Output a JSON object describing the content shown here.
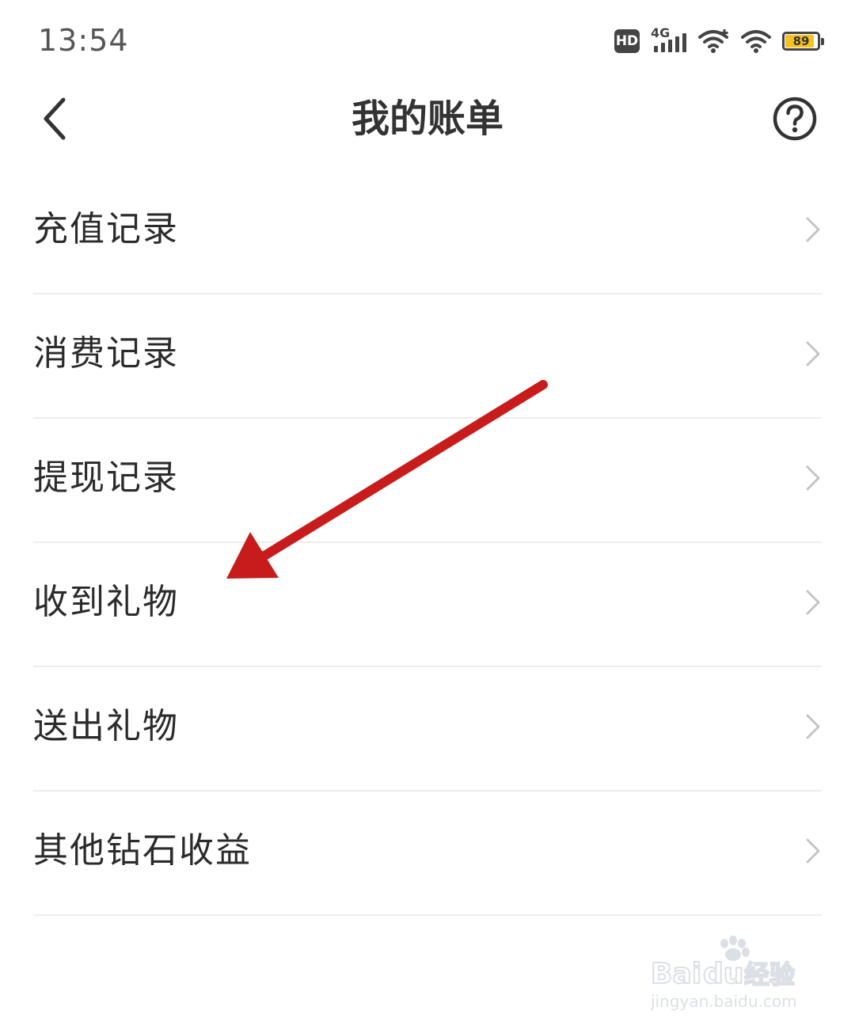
{
  "status_bar": {
    "time": "13:54",
    "hd_label": "HD",
    "network_label": "4G",
    "battery_level": "89",
    "battery_fraction": 0.89,
    "icons": [
      "hd-icon",
      "signal-icon",
      "wifi-plus-icon",
      "wifi-icon",
      "battery-icon"
    ],
    "battery_color": "#f7c21e"
  },
  "nav": {
    "title": "我的账单",
    "back_icon": "chevron-left-icon",
    "help_icon": "question-circle-icon"
  },
  "menu": {
    "items": [
      {
        "label": "充值记录"
      },
      {
        "label": "消费记录"
      },
      {
        "label": "提现记录"
      },
      {
        "label": "收到礼物"
      },
      {
        "label": "送出礼物"
      },
      {
        "label": "其他钻石收益"
      }
    ],
    "chevron_icon": "chevron-right-icon"
  },
  "annotation": {
    "arrow_color": "#c81c1c"
  },
  "watermark": {
    "brand": "Baidu经验",
    "url": "jingyan.baidu.com"
  }
}
